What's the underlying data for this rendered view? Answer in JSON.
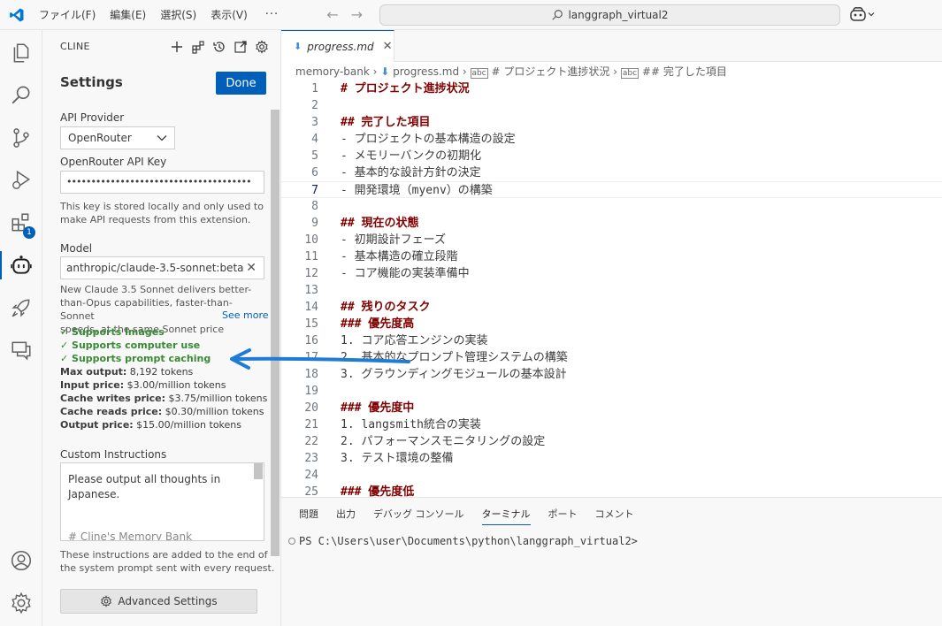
{
  "titlebar": {
    "menus": [
      "ファイル(F)",
      "編集(E)",
      "選択(S)",
      "表示(V)"
    ],
    "more": "···",
    "search_text": "langgraph_virtual2"
  },
  "activitybar": {
    "items": [
      "explorer-icon",
      "search-icon",
      "source-control-icon",
      "run-debug-icon",
      "extensions-icon",
      "cline-icon",
      "rocket-icon",
      "chat-icon"
    ],
    "extensions_badge": "1",
    "bottom_items": [
      "account-icon",
      "manage-gear-icon"
    ]
  },
  "sidepanel": {
    "header": "CLINE",
    "title": "Settings",
    "done_label": "Done",
    "api_provider_label": "API Provider",
    "api_provider_value": "OpenRouter",
    "api_key_label": "OpenRouter API Key",
    "api_key_value": "••••••••••••••••••••••••••••••••••••••",
    "api_key_note_1": "This key is stored locally and only used to",
    "api_key_note_2": "make API requests from this extension.",
    "model_label": "Model",
    "model_value": "anthropic/claude-3.5-sonnet:beta",
    "model_desc_1": "New Claude 3.5 Sonnet delivers better-",
    "model_desc_2": "than-Opus capabilities, faster-than-Sonnet",
    "model_desc_3": "speeds, at the same Sonnet price",
    "see_more": "See more",
    "features": [
      "✓ Supports images",
      "✓ Supports computer use",
      "✓ Supports prompt caching"
    ],
    "specs": [
      {
        "k": "Max output:",
        "v": " 8,192 tokens"
      },
      {
        "k": "Input price:",
        "v": " $3.00/million tokens"
      },
      {
        "k": "Cache writes price:",
        "v": " $3.75/million tokens"
      },
      {
        "k": "Cache reads price:",
        "v": " $0.30/million tokens"
      },
      {
        "k": "Output price:",
        "v": " $15.00/million tokens"
      }
    ],
    "custom_label": "Custom Instructions",
    "custom_line_1": "Please output all thoughts in",
    "custom_line_2": "Japanese.",
    "custom_line_3": "# Cline's Memory Bank",
    "custom_note_1": "These instructions are added to the end of",
    "custom_note_2": "the system prompt sent with every request.",
    "advanced_label": "Advanced Settings"
  },
  "editor": {
    "tab_name": "progress.md",
    "tab_icon": "markdown-file-icon",
    "breadcrumb": [
      "memory-bank",
      "progress.md",
      "# プロジェクト進捗状況",
      "## 完了した項目"
    ],
    "lines": [
      {
        "n": "1",
        "t": "# プロジェクト進捗状況",
        "h": true
      },
      {
        "n": "2",
        "t": ""
      },
      {
        "n": "3",
        "t": "## 完了した項目",
        "h": true
      },
      {
        "n": "4",
        "t": "- プロジェクトの基本構造の設定"
      },
      {
        "n": "5",
        "t": "- メモリーバンクの初期化"
      },
      {
        "n": "6",
        "t": "- 基本的な設計方針の決定"
      },
      {
        "n": "7",
        "t": "- 開発環境（myenv）の構築"
      },
      {
        "n": "8",
        "t": ""
      },
      {
        "n": "9",
        "t": "## 現在の状態",
        "h": true
      },
      {
        "n": "10",
        "t": "- 初期設計フェーズ"
      },
      {
        "n": "11",
        "t": "- 基本構造の確立段階"
      },
      {
        "n": "12",
        "t": "- コア機能の実装準備中"
      },
      {
        "n": "13",
        "t": ""
      },
      {
        "n": "14",
        "t": "## 残りのタスク",
        "h": true
      },
      {
        "n": "15",
        "t": "### 優先度高",
        "h": true
      },
      {
        "n": "16",
        "t": "1. コア応答エンジンの実装"
      },
      {
        "n": "17",
        "t": "2. 基本的なプロンプト管理システムの構築"
      },
      {
        "n": "18",
        "t": "3. グラウンディングモジュールの基本設計"
      },
      {
        "n": "19",
        "t": ""
      },
      {
        "n": "20",
        "t": "### 優先度中",
        "h": true
      },
      {
        "n": "21",
        "t": "1. langsmith統合の実装"
      },
      {
        "n": "22",
        "t": "2. パフォーマンスモニタリングの設定"
      },
      {
        "n": "23",
        "t": "3. テスト環境の整備"
      },
      {
        "n": "24",
        "t": ""
      },
      {
        "n": "25",
        "t": "### 優先度低",
        "h": true
      }
    ]
  },
  "bottom_panel": {
    "tabs": [
      "問題",
      "出力",
      "デバッグ コンソール",
      "ターミナル",
      "ポート",
      "コメント"
    ],
    "active_tab": "ターミナル",
    "terminal_line": "PS C:\\Users\\user\\Documents\\python\\langgraph_virtual2>"
  },
  "colors": {
    "accent": "#005fb8",
    "success": "#388a34",
    "heading": "#800000",
    "annotation_arrow": "#1f7bd6"
  }
}
